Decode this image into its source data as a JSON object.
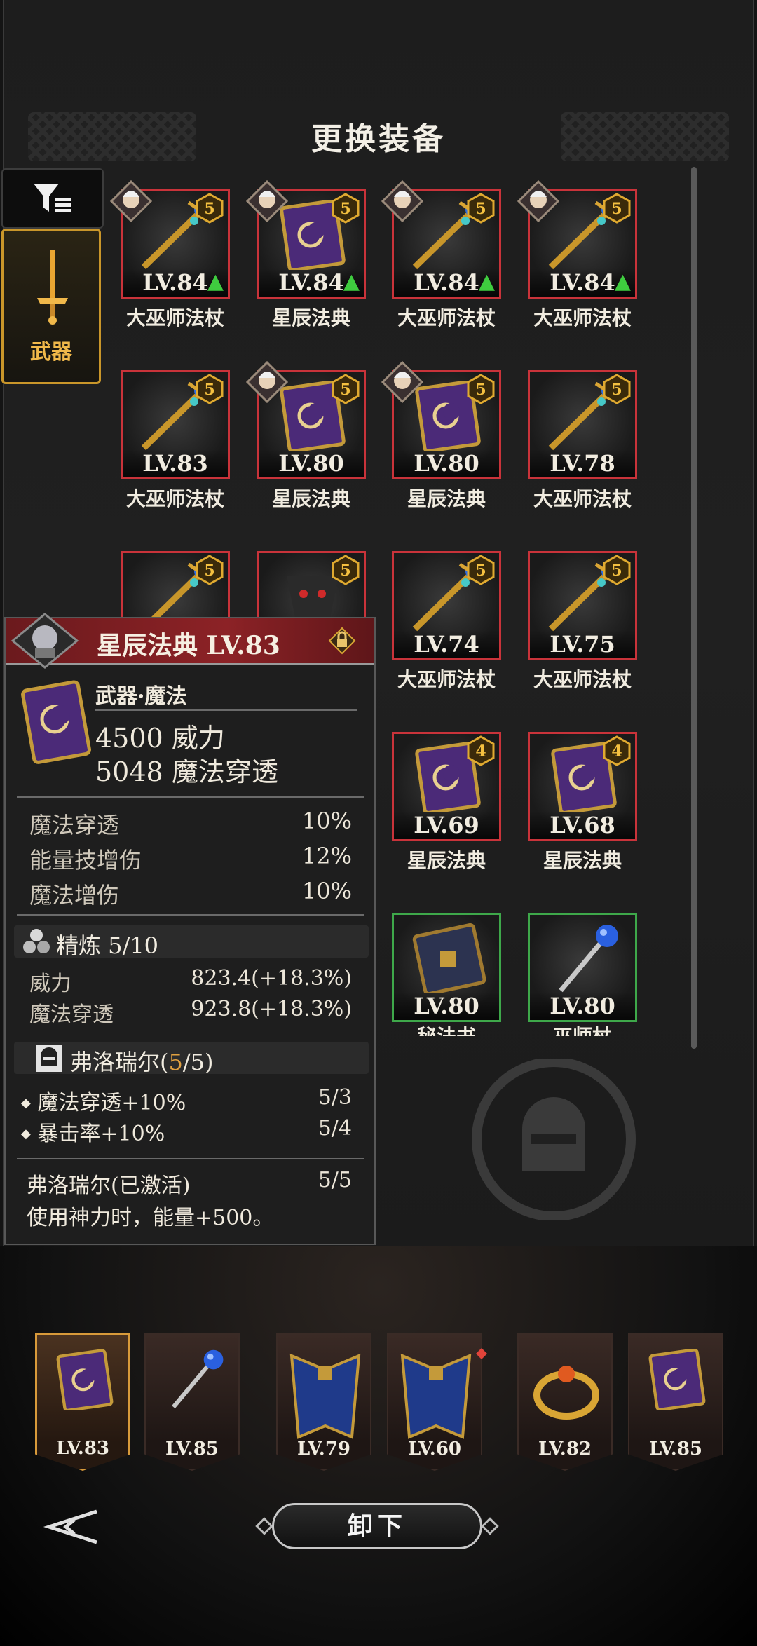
{
  "screen_title": "更换装备",
  "side_tabs": {
    "filter_icon": "filter-icon",
    "weapon_label": "武器"
  },
  "grid": [
    {
      "level": "LV.84",
      "name": "大巫师法杖",
      "type": "staff",
      "badge": "5",
      "portrait": true,
      "upgrade": true,
      "border": "red"
    },
    {
      "level": "LV.84",
      "name": "星辰法典",
      "type": "book",
      "badge": "5",
      "portrait": true,
      "upgrade": true,
      "border": "red"
    },
    {
      "level": "LV.84",
      "name": "大巫师法杖",
      "type": "staff",
      "badge": "5",
      "portrait": true,
      "upgrade": true,
      "border": "red"
    },
    {
      "level": "LV.84",
      "name": "大巫师法杖",
      "type": "staff",
      "badge": "5",
      "portrait": true,
      "upgrade": true,
      "border": "red"
    },
    {
      "level": "LV.83",
      "name": "大巫师法杖",
      "type": "staff",
      "badge": "5",
      "portrait": false,
      "upgrade": false,
      "border": "red"
    },
    {
      "level": "LV.80",
      "name": "星辰法典",
      "type": "book",
      "badge": "5",
      "portrait": true,
      "upgrade": false,
      "border": "red"
    },
    {
      "level": "LV.80",
      "name": "星辰法典",
      "type": "book",
      "badge": "5",
      "portrait": true,
      "upgrade": false,
      "border": "red"
    },
    {
      "level": "LV.78",
      "name": "大巫师法杖",
      "type": "staff",
      "badge": "5",
      "portrait": false,
      "upgrade": false,
      "border": "red"
    },
    {
      "level": "LV.74",
      "name": "大巫师法杖",
      "type": "staff",
      "badge": "5",
      "portrait": false,
      "upgrade": false,
      "border": "red"
    },
    {
      "level": "LV.75",
      "name": "大巫师法杖",
      "type": "staff",
      "badge": "5",
      "portrait": false,
      "upgrade": false,
      "border": "red"
    },
    {
      "level": "LV.69",
      "name": "星辰法典",
      "type": "book",
      "badge": "4",
      "portrait": false,
      "upgrade": false,
      "border": "red"
    },
    {
      "level": "LV.68",
      "name": "星辰法典",
      "type": "book",
      "badge": "4",
      "portrait": false,
      "upgrade": false,
      "border": "red"
    },
    {
      "level": "LV.80",
      "name": "秘法书",
      "type": "darkbook",
      "badge": "",
      "portrait": false,
      "upgrade": false,
      "border": "green"
    },
    {
      "level": "LV.80",
      "name": "巫师杖",
      "type": "bluestaff",
      "badge": "",
      "portrait": false,
      "upgrade": false,
      "border": "green"
    }
  ],
  "partial_items": [
    {
      "badge": "5",
      "type": "staff"
    },
    {
      "badge": "5",
      "type": "mask"
    }
  ],
  "tooltip": {
    "title": "星辰法典 LV.83",
    "category": "武器·魔法",
    "main_stats": [
      {
        "value": "4500",
        "label": "威力"
      },
      {
        "value": "5048",
        "label": "魔法穿透"
      }
    ],
    "sub_stats": [
      {
        "label": "魔法穿透",
        "value": "10%"
      },
      {
        "label": "能量技增伤",
        "value": "12%"
      },
      {
        "label": "魔法增伤",
        "value": "10%"
      }
    ],
    "refine": {
      "title": "精炼 5/10",
      "rows": [
        {
          "label": "威力",
          "value": "823.4(+18.3%)"
        },
        {
          "label": "魔法穿透",
          "value": "923.8(+18.3%)"
        }
      ]
    },
    "set": {
      "name": "弗洛瑞尔",
      "count": "5",
      "total": "5",
      "bonuses": [
        {
          "label": "魔法穿透+10%",
          "value": "5/3"
        },
        {
          "label": "暴击率+10%",
          "value": "5/4"
        }
      ],
      "active_label": "弗洛瑞尔(已激活)",
      "active_value": "5/5",
      "description": "使用神力时，能量+500。"
    }
  },
  "equipped": [
    {
      "level": "LV.83",
      "type": "book",
      "selected": true
    },
    {
      "level": "LV.85",
      "type": "bluestaff",
      "selected": false
    },
    {
      "level": "LV.79",
      "type": "cape",
      "selected": false
    },
    {
      "level": "LV.60",
      "type": "cape",
      "selected": false
    },
    {
      "level": "LV.82",
      "type": "ring",
      "selected": false
    },
    {
      "level": "LV.85",
      "type": "tome",
      "selected": false
    }
  ],
  "unequip_label": "卸下",
  "colors": {
    "rare_border": "#c9333a",
    "uncommon_border": "#3ea84a",
    "gold": "#d9a534",
    "tooltip_header": "#8c2226",
    "set_count": "#e0a040"
  }
}
